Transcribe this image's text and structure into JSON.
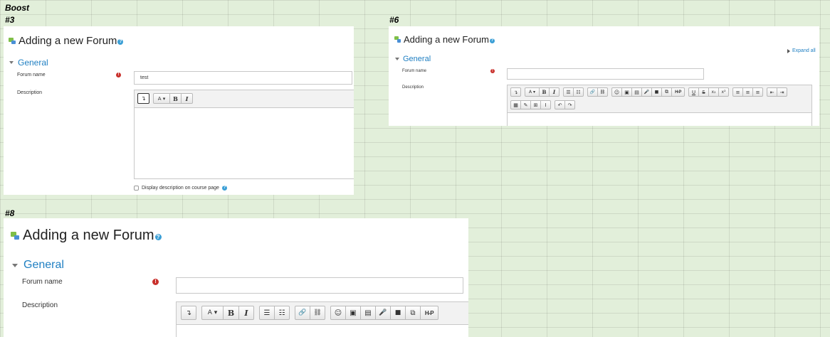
{
  "sheet": {
    "title": "Boost"
  },
  "panels": {
    "p3": {
      "label": "#3",
      "page_title": "Adding a new Forum",
      "help": "?",
      "section": "General",
      "forum_name_label": "Forum name",
      "required_mark": "!",
      "forum_name_value": "test",
      "description_label": "Description",
      "toolbar": [
        "↴",
        "A ▾",
        "B",
        "I"
      ],
      "checkbox_label": "Display description on course page"
    },
    "p6": {
      "label": "#6",
      "page_title": "Adding a new Forum",
      "help": "?",
      "expand_all": "Expand all",
      "section": "General",
      "forum_name_label": "Forum name",
      "required_mark": "!",
      "forum_name_value": "",
      "description_label": "Description",
      "toolbar_row1": [
        "↴",
        "A ▾",
        "B",
        "I",
        "☰",
        "☷",
        "🔗",
        "⛓",
        "☺",
        "▣",
        "▤",
        "🎤",
        "■",
        "⧉",
        "H-P",
        "U",
        "S",
        "x₂",
        "x²",
        "≡",
        "≡",
        "≡",
        "⇤",
        "⇥"
      ],
      "toolbar_row2": [
        "▦",
        "✎",
        "⊞",
        "I",
        "↶",
        "↷"
      ]
    },
    "p8": {
      "label": "#8",
      "page_title": "Adding a new Forum",
      "help": "?",
      "section": "General",
      "forum_name_label": "Forum name",
      "required_mark": "!",
      "forum_name_value": "",
      "description_label": "Description",
      "toolbar": [
        "↴",
        "A ▾",
        "B",
        "I",
        "☰",
        "☷",
        "🔗",
        "⛓",
        "☺",
        "▣",
        "▤",
        "🎤",
        "■",
        "⧉",
        "H-P"
      ]
    }
  },
  "colors": {
    "link": "#1f7fc2",
    "required": "#c9302c",
    "help": "#3b9fd6",
    "sheet_bg": "#e2efda"
  }
}
